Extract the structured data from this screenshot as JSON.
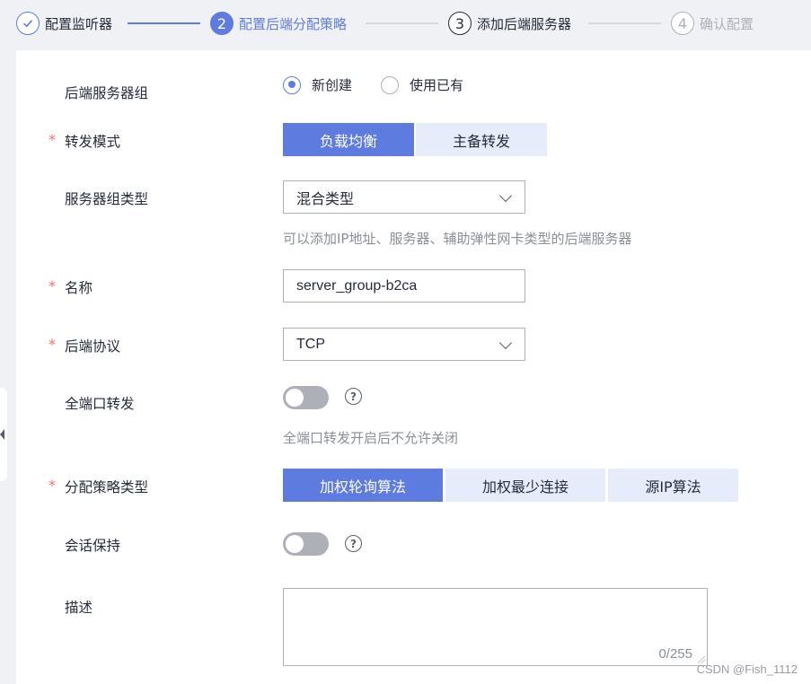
{
  "stepper": {
    "steps": [
      {
        "number": "✓",
        "label": "配置监听器",
        "state": "done"
      },
      {
        "number": "2",
        "label": "配置后端分配策略",
        "state": "active"
      },
      {
        "number": "3",
        "label": "添加后端服务器",
        "state": "todo"
      },
      {
        "number": "4",
        "label": "确认配置",
        "state": "disabled"
      }
    ]
  },
  "form": {
    "required_mark": "*",
    "backend_group": {
      "label": "后端服务器组",
      "options": [
        {
          "label": "新创建",
          "checked": true
        },
        {
          "label": "使用已有",
          "checked": false
        }
      ]
    },
    "forward_mode": {
      "label": "转发模式",
      "options": [
        {
          "label": "负载均衡",
          "selected": true
        },
        {
          "label": "主备转发",
          "selected": false
        }
      ]
    },
    "group_type": {
      "label": "服务器组类型",
      "value": "混合类型",
      "hint": "可以添加IP地址、服务器、辅助弹性网卡类型的后端服务器"
    },
    "name": {
      "label": "名称",
      "value": "server_group-b2ca"
    },
    "protocol": {
      "label": "后端协议",
      "value": "TCP"
    },
    "all_port": {
      "label": "全端口转发",
      "enabled": false,
      "hint": "全端口转发开启后不允许关闭"
    },
    "algorithm": {
      "label": "分配策略类型",
      "options": [
        {
          "label": "加权轮询算法",
          "selected": true
        },
        {
          "label": "加权最少连接",
          "selected": false
        },
        {
          "label": "源IP算法",
          "selected": false
        }
      ]
    },
    "session": {
      "label": "会话保持",
      "enabled": false
    },
    "description": {
      "label": "描述",
      "value": "",
      "counter": "0/255"
    }
  },
  "help_glyph": "?",
  "watermark": "CSDN @Fish_1112",
  "colors": {
    "accent": "#5e7ce0",
    "required": "#f66f6a",
    "segment_off": "#e7ecfa",
    "toggle_off": "#adb0b8"
  }
}
